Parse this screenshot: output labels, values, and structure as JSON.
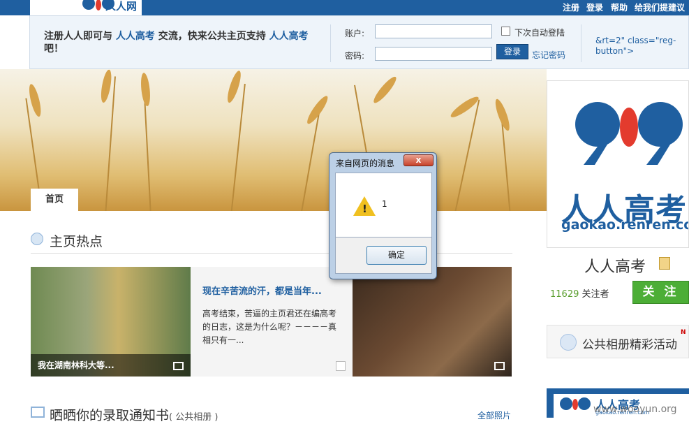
{
  "nav": {
    "logo_text": "人人网",
    "links": [
      "注册",
      "登录",
      "帮助",
      "给我们提建议"
    ]
  },
  "login": {
    "promo_prefix": "注册人人即可与",
    "promo_brand": "人人高考",
    "promo_middle": "交流，快来公共主页支持",
    "promo_brand2": "人人高考",
    "promo_suffix": "吧！",
    "account_label": "账户:",
    "password_label": "密码:",
    "account_value": "",
    "password_value": "",
    "remember_label": "下次自动登陆",
    "login_button": "登录",
    "forgot_link": "忘记密码",
    "leaked_code": "&rt=2\" class=\"reg-button\">"
  },
  "tabs": {
    "home": "首页"
  },
  "hot": {
    "title": "主页热点",
    "left_caption": "我在湖南林科大等...",
    "article_title": "现在辛苦流的汗，都是当年...",
    "article_body": "高考结束，苦逼的主页君还在编高考的日志，这是为什么呢？－－－－真相只有一..."
  },
  "photos": {
    "title": "晒晒你的录取通知书",
    "subtitle": "( 公共相册 )",
    "all_link": "全部照片"
  },
  "profile": {
    "brand_text": "人人高考",
    "domain_text": "gaokao.renren.com",
    "name": "人人高考",
    "follower_count": "11629",
    "follower_label": "关注者",
    "follow_button": "关 注"
  },
  "activity": {
    "label": "公共相册精彩活动",
    "badge": "N"
  },
  "promo": {
    "text": "人人高考",
    "url": "gaokao.renren.com"
  },
  "watermark": "www.wooyun.org",
  "dialog": {
    "title": "来自网页的消息",
    "close_label": "x",
    "message": "1",
    "ok_button": "确定"
  },
  "colors": {
    "brand_blue": "#1f5fa0",
    "follow_green": "#4cae36",
    "dialog_close_red": "#c8432b"
  },
  "icons": [
    "renren-logo-icon",
    "section-fire-icon",
    "image-icon",
    "edit-icon",
    "star-icon",
    "activity-icon",
    "warning-icon",
    "close-icon",
    "album-icon"
  ]
}
